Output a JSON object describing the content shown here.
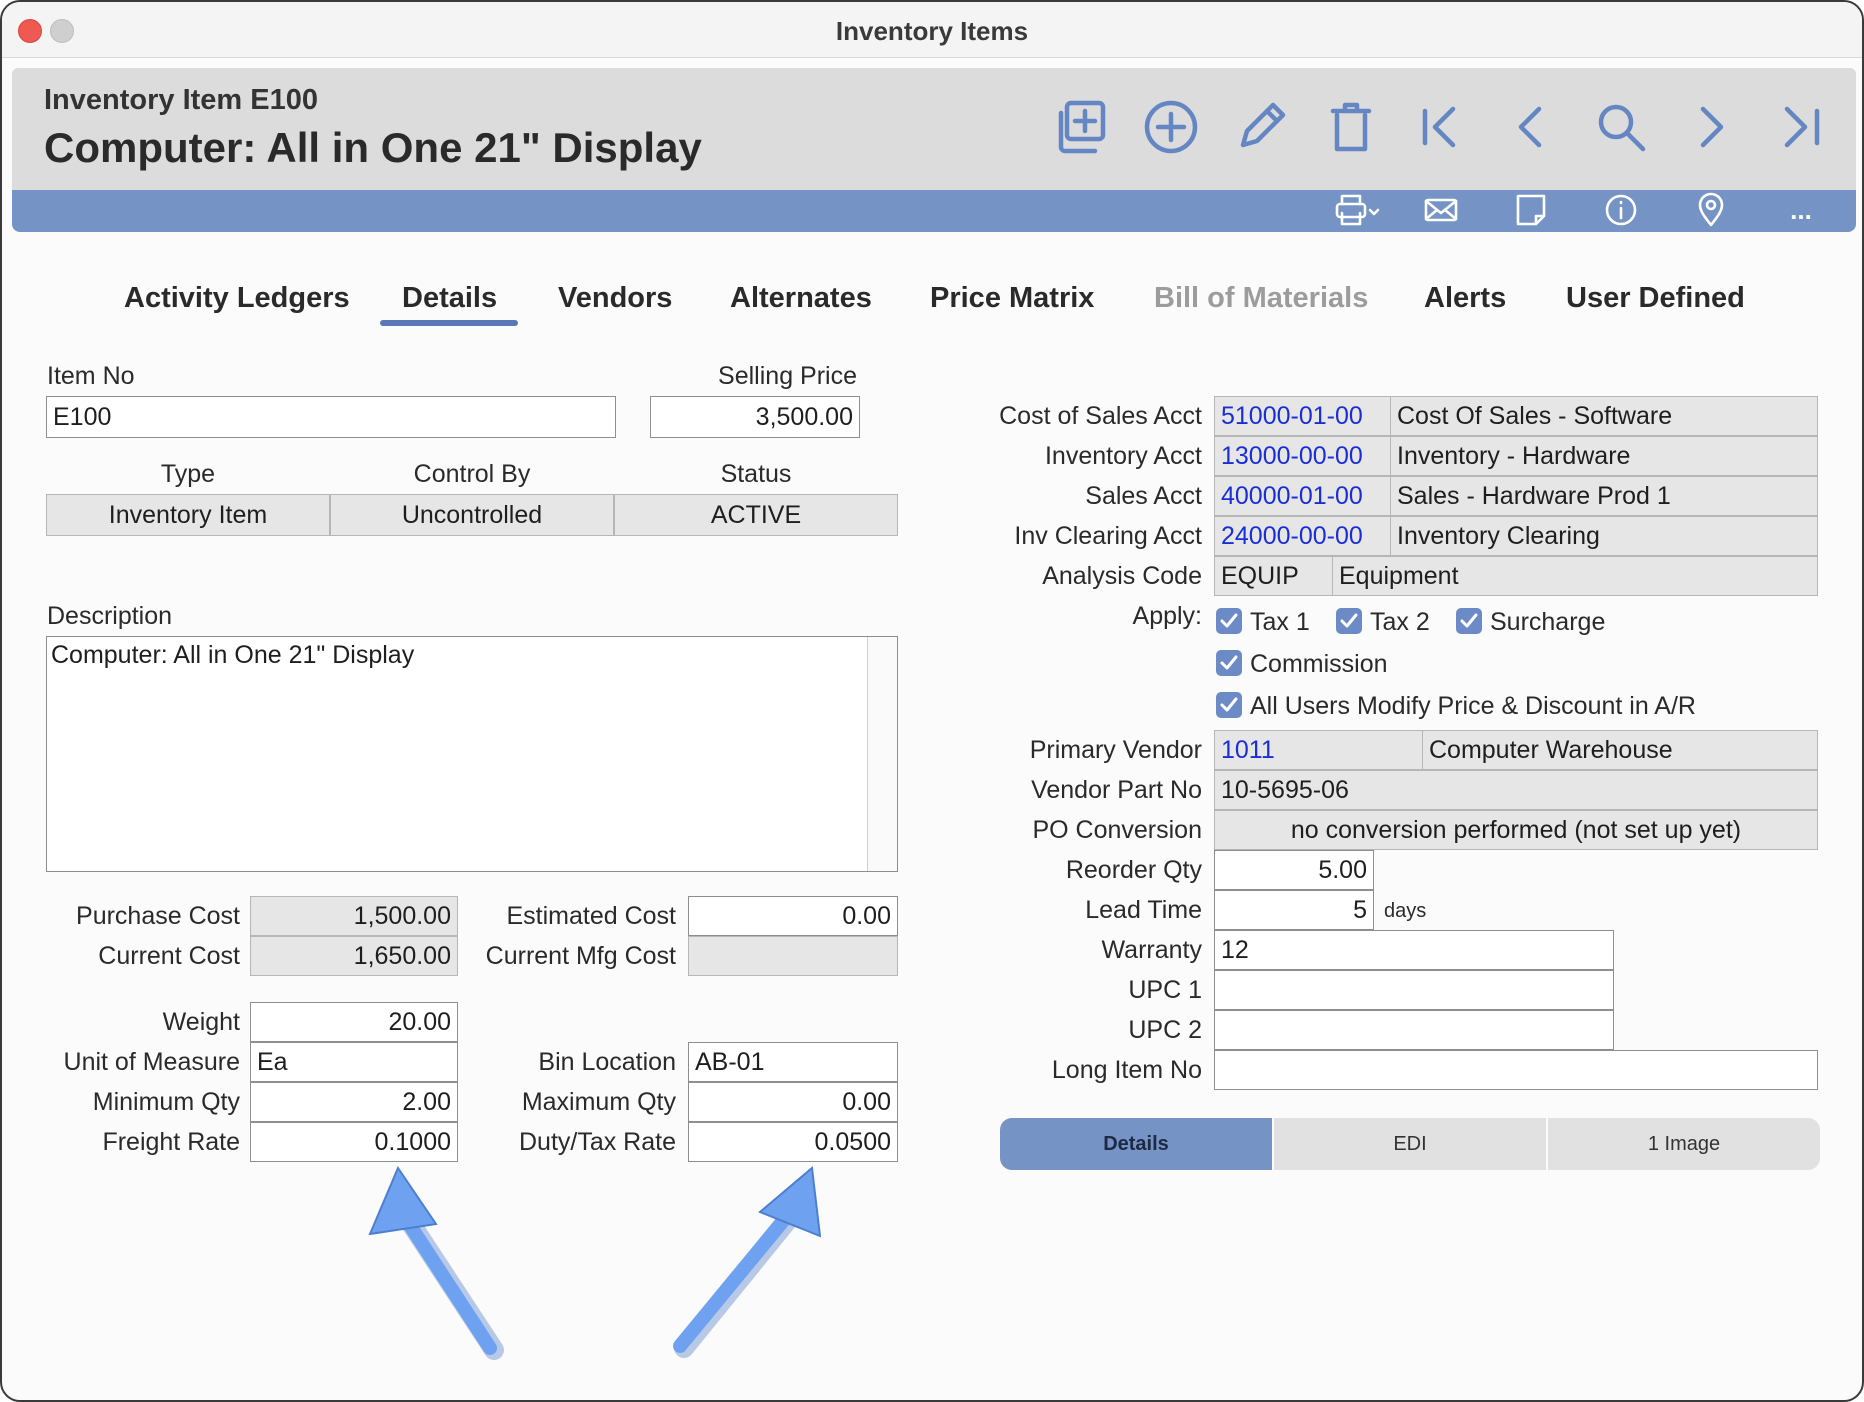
{
  "window": {
    "title": "Inventory Items"
  },
  "header": {
    "record_label": "Inventory Item E100",
    "record_title": "Computer: All in One 21\" Display"
  },
  "toolbar": {
    "buttons": [
      "duplicate-icon",
      "add-icon",
      "edit-icon",
      "delete-icon",
      "first-record-icon",
      "previous-record-icon",
      "search-icon",
      "next-record-icon",
      "last-record-icon"
    ],
    "actions": [
      "print-icon",
      "email-icon",
      "note-icon",
      "info-icon",
      "location-icon",
      "more-icon"
    ],
    "more_label": "..."
  },
  "tabs": [
    "Activity Ledgers",
    "Details",
    "Vendors",
    "Alternates",
    "Price Matrix",
    "Bill of Materials",
    "Alerts",
    "User Defined"
  ],
  "active_tab": "Details",
  "form": {
    "item_no_label": "Item No",
    "item_no": "E100",
    "selling_price_label": "Selling Price",
    "selling_price": "3,500.00",
    "type_label": "Type",
    "type": "Inventory Item",
    "control_by_label": "Control By",
    "control_by": "Uncontrolled",
    "status_label": "Status",
    "status": "ACTIVE",
    "description_label": "Description",
    "description": "Computer: All in One 21\" Display",
    "purchase_cost_label": "Purchase Cost",
    "purchase_cost": "1,500.00",
    "current_cost_label": "Current Cost",
    "current_cost": "1,650.00",
    "estimated_cost_label": "Estimated Cost",
    "estimated_cost": "0.00",
    "current_mfg_cost_label": "Current Mfg Cost",
    "current_mfg_cost": "",
    "weight_label": "Weight",
    "weight": "20.00",
    "uom_label": "Unit of Measure",
    "uom": "Ea",
    "bin_location_label": "Bin Location",
    "bin_location": "AB-01",
    "minimum_qty_label": "Minimum Qty",
    "minimum_qty": "2.00",
    "maximum_qty_label": "Maximum Qty",
    "maximum_qty": "0.00",
    "freight_rate_label": "Freight Rate",
    "freight_rate": "0.1000",
    "duty_tax_rate_label": "Duty/Tax Rate",
    "duty_tax_rate": "0.0500"
  },
  "accounts": [
    {
      "label": "Cost of Sales Acct",
      "code": "51000-01-00",
      "name": "Cost Of Sales - Software"
    },
    {
      "label": "Inventory Acct",
      "code": "13000-00-00",
      "name": "Inventory - Hardware"
    },
    {
      "label": "Sales Acct",
      "code": "40000-01-00",
      "name": "Sales - Hardware Prod 1"
    },
    {
      "label": "Inv Clearing Acct",
      "code": "24000-00-00",
      "name": "Inventory Clearing"
    }
  ],
  "analysis": {
    "label": "Analysis Code",
    "code": "EQUIP",
    "name": "Equipment"
  },
  "apply": {
    "label": "Apply:",
    "tax1": "Tax 1",
    "tax2": "Tax 2",
    "surcharge": "Surcharge",
    "commission": "Commission",
    "all_users": "All Users Modify Price & Discount in A/R"
  },
  "vendor": {
    "primary_label": "Primary Vendor",
    "primary_code": "1011",
    "primary_name": "Computer Warehouse",
    "part_no_label": "Vendor Part No",
    "part_no": "10-5695-06",
    "po_conversion_label": "PO Conversion",
    "po_conversion": "no conversion performed (not set up yet)",
    "reorder_qty_label": "Reorder Qty",
    "reorder_qty": "5.00",
    "lead_time_label": "Lead Time",
    "lead_time": "5",
    "lead_time_unit": "days",
    "warranty_label": "Warranty",
    "warranty": "12",
    "upc1_label": "UPC 1",
    "upc1": "",
    "upc2_label": "UPC 2",
    "upc2": "",
    "long_item_no_label": "Long Item No",
    "long_item_no": ""
  },
  "subtabs": [
    "Details",
    "EDI",
    "1 Image"
  ],
  "colors": {
    "accent": "#7593c4",
    "link": "#1a2ed6",
    "arrow": "#6ea2f0",
    "close": "#ee5a52"
  }
}
